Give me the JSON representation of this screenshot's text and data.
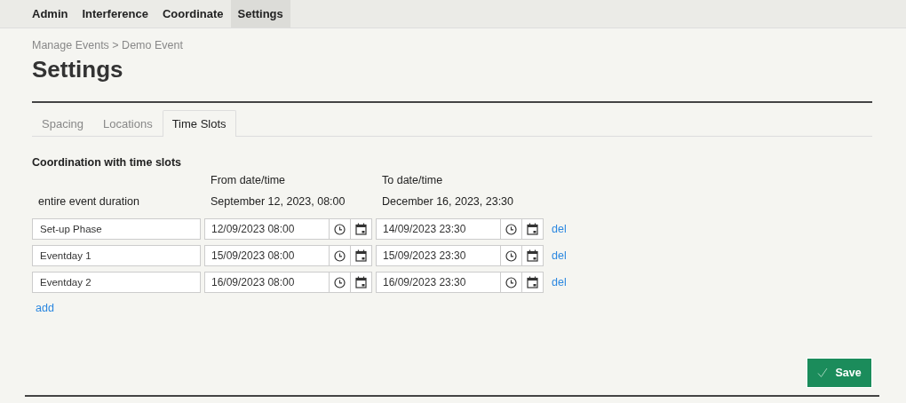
{
  "nav": [
    {
      "label": "Admin",
      "selected": false
    },
    {
      "label": "Interference",
      "selected": false
    },
    {
      "label": "Coordinate",
      "selected": false
    },
    {
      "label": "Settings",
      "selected": true
    }
  ],
  "breadcrumb": "Manage Events > Demo Event",
  "title": "Settings",
  "tabs": [
    {
      "label": "Spacing",
      "selected": false
    },
    {
      "label": "Locations",
      "selected": false
    },
    {
      "label": "Time Slots",
      "selected": true
    }
  ],
  "section_title": "Coordination with time slots",
  "columns": {
    "from": "From date/time",
    "to": "To date/time"
  },
  "event_duration": {
    "label": "entire event duration",
    "from": "September 12, 2023, 08:00",
    "to": "December 16, 2023, 23:30"
  },
  "slots": [
    {
      "name": "Set-up Phase",
      "from": "12/09/2023 08:00",
      "to": "14/09/2023 23:30",
      "delete": "del"
    },
    {
      "name": "Eventday 1",
      "from": "15/09/2023 08:00",
      "to": "15/09/2023 23:30",
      "delete": "del"
    },
    {
      "name": "Eventday 2",
      "from": "16/09/2023 08:00",
      "to": "16/09/2023 23:30",
      "delete": "del"
    }
  ],
  "add": "add",
  "save_button": "Save"
}
